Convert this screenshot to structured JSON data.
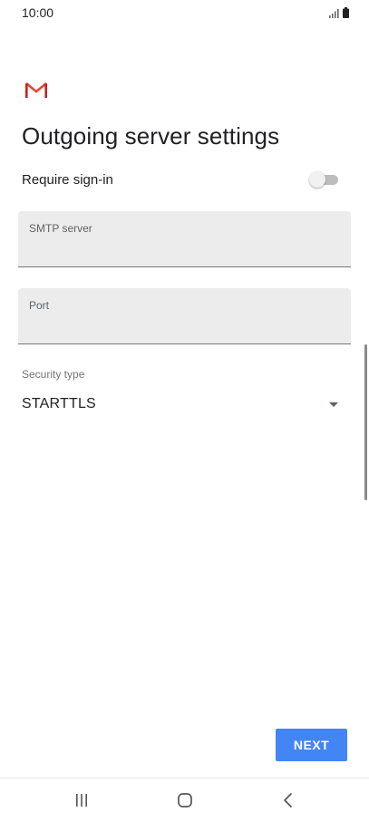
{
  "status_bar": {
    "time": "10:00",
    "icons": [
      "signal-icon",
      "battery-icon"
    ]
  },
  "header": {
    "logo": "gmail-logo",
    "title": "Outgoing server settings"
  },
  "require_signin": {
    "label": "Require sign-in",
    "enabled": false
  },
  "fields": {
    "smtp_server": {
      "label": "SMTP server",
      "value": ""
    },
    "port": {
      "label": "Port",
      "value": ""
    }
  },
  "security": {
    "label": "Security type",
    "value": "STARTTLS"
  },
  "actions": {
    "next_label": "NEXT"
  },
  "nav_bar": {
    "buttons": [
      "recent-apps-icon",
      "home-icon",
      "back-icon"
    ]
  },
  "colors": {
    "accent": "#4285f4",
    "field_background": "#ececec",
    "gmail_red": "#ea4335"
  }
}
